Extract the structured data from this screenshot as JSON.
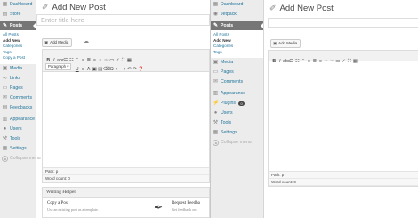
{
  "left": {
    "sidebar": {
      "top_items": [
        {
          "label": "Dashboard",
          "icon": "dashboard-icon"
        },
        {
          "label": "Store",
          "icon": "store-icon"
        }
      ],
      "active_item": {
        "label": "Posts",
        "icon": "pin-icon"
      },
      "submenu": [
        "All Posts",
        "Add New",
        "Categories",
        "Tags",
        "Copy a Post"
      ],
      "current_submenu": "Add New",
      "items": [
        {
          "label": "Media",
          "icon": "media-icon"
        },
        {
          "label": "Links",
          "icon": "link-icon"
        },
        {
          "label": "Pages",
          "icon": "pages-icon"
        },
        {
          "label": "Comments",
          "icon": "comments-icon"
        },
        {
          "label": "Feedbacks",
          "icon": "feedback-icon"
        }
      ],
      "items2": [
        {
          "label": "Appearance",
          "icon": "appearance-icon"
        },
        {
          "label": "Users",
          "icon": "users-icon"
        },
        {
          "label": "Tools",
          "icon": "tools-icon"
        },
        {
          "label": "Settings",
          "icon": "settings-icon"
        }
      ],
      "collapse": "Collapse menu"
    },
    "heading": "Add New Post",
    "title_placeholder": "Enter title here",
    "add_media": "Add Media",
    "paragraph": "Paragraph",
    "path": "Path: p",
    "word_count": "Word count: 0",
    "writing_helper": {
      "title": "Writing Helper",
      "card1_title": "Copy a Post",
      "card1_desc": "Use an existing post as a template.",
      "card2_title": "Request Feedba",
      "card2_desc": "Get feedback on"
    }
  },
  "right": {
    "sidebar": {
      "top_items": [
        {
          "label": "Dashboard",
          "icon": "dashboard-icon"
        },
        {
          "label": "Jetpack",
          "icon": "jetpack-icon"
        }
      ],
      "active_item": {
        "label": "Posts",
        "icon": "pin-icon"
      },
      "submenu": [
        "All Posts",
        "Add New",
        "Categories",
        "Tags"
      ],
      "current_submenu": "Add New",
      "items": [
        {
          "label": "Media",
          "icon": "media-icon"
        },
        {
          "label": "Pages",
          "icon": "pages-icon"
        },
        {
          "label": "Comments",
          "icon": "comments-icon"
        }
      ],
      "items2": [
        {
          "label": "Appearance",
          "icon": "appearance-icon"
        },
        {
          "label": "Plugins",
          "icon": "plugins-icon",
          "badge": "0"
        },
        {
          "label": "Users",
          "icon": "users-icon"
        },
        {
          "label": "Tools",
          "icon": "tools-icon"
        },
        {
          "label": "Settings",
          "icon": "settings-icon"
        }
      ],
      "collapse": "Collapse menu"
    },
    "heading": "Add New Post",
    "title_value": "",
    "add_media": "Add Media",
    "path": "Path: p",
    "word_count": "Word count: 0"
  },
  "colors": {
    "link": "#21759b",
    "active_menu_bg": "#767676",
    "sidebar_bg": "#ececec"
  }
}
